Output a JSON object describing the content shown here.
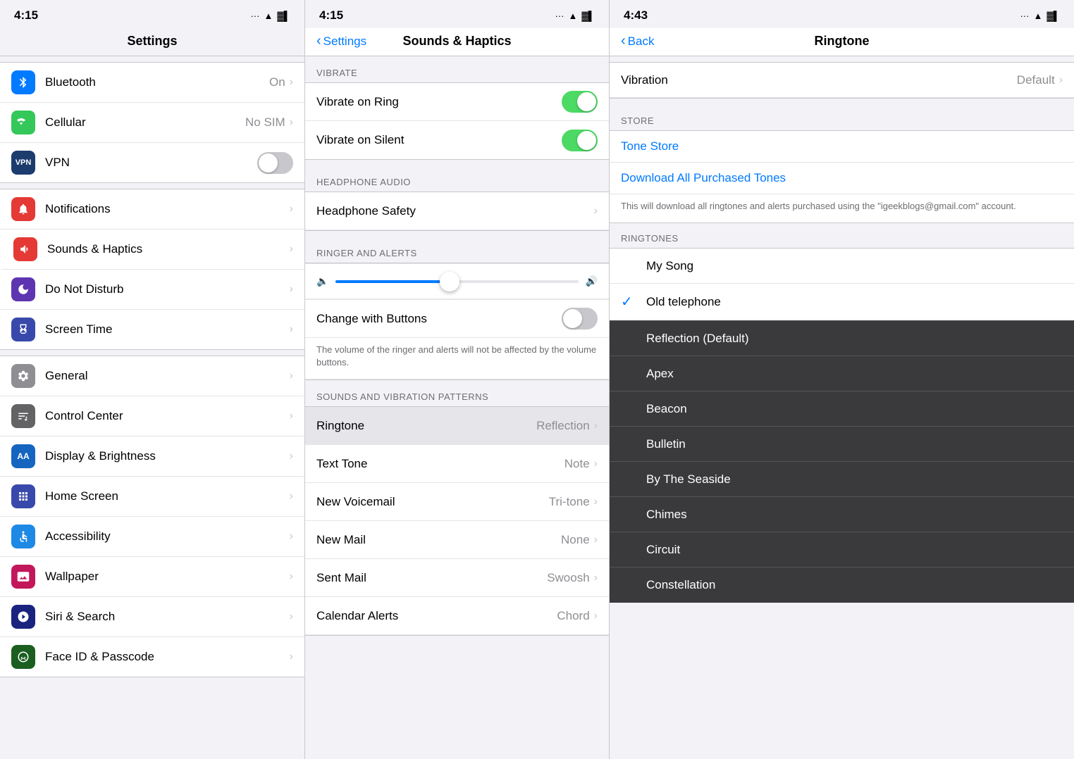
{
  "panel1": {
    "status": {
      "time": "4:15",
      "signal": "···",
      "wifi": "WiFi",
      "battery": "🔋"
    },
    "title": "Settings",
    "groups": [
      {
        "items": [
          {
            "icon": "bluetooth",
            "iconClass": "icon-blue",
            "label": "Bluetooth",
            "value": "On",
            "chevron": true
          },
          {
            "icon": "cellular",
            "iconClass": "icon-green",
            "label": "Cellular",
            "value": "No SIM",
            "chevron": true
          },
          {
            "icon": "vpn",
            "iconClass": "icon-dark-blue",
            "label": "VPN",
            "toggle": true,
            "toggleOn": false
          }
        ]
      },
      {
        "items": [
          {
            "icon": "bell",
            "iconClass": "icon-red",
            "label": "Notifications",
            "chevron": true
          },
          {
            "icon": "speaker",
            "iconClass": "icon-sound",
            "label": "Sounds & Haptics",
            "chevron": true,
            "active": true
          },
          {
            "icon": "moon",
            "iconClass": "icon-purple",
            "label": "Do Not Disturb",
            "chevron": true
          },
          {
            "icon": "hourglass",
            "iconClass": "icon-indigo",
            "label": "Screen Time",
            "chevron": true
          }
        ]
      },
      {
        "items": [
          {
            "icon": "gear",
            "iconClass": "icon-gray",
            "label": "General",
            "chevron": true
          },
          {
            "icon": "control",
            "iconClass": "icon-dark-gray",
            "label": "Control Center",
            "chevron": true
          },
          {
            "icon": "aa",
            "iconClass": "icon-aa",
            "label": "Display & Brightness",
            "chevron": true
          },
          {
            "icon": "dots",
            "iconClass": "icon-dots",
            "label": "Home Screen",
            "chevron": true
          },
          {
            "icon": "accessibility",
            "iconClass": "icon-accessibility",
            "label": "Accessibility",
            "chevron": true
          },
          {
            "icon": "wallpaper",
            "iconClass": "icon-wallpaper",
            "label": "Wallpaper",
            "chevron": true
          },
          {
            "icon": "siri",
            "iconClass": "icon-siri",
            "label": "Siri & Search",
            "chevron": true
          },
          {
            "icon": "faceid",
            "iconClass": "icon-faceid",
            "label": "Face ID & Passcode",
            "chevron": true
          }
        ]
      }
    ]
  },
  "panel2": {
    "status": {
      "time": "4:15"
    },
    "navBack": "Settings",
    "title": "Sounds & Haptics",
    "sections": {
      "vibrate": {
        "header": "VIBRATE",
        "items": [
          {
            "label": "Vibrate on Ring",
            "toggleOn": true
          },
          {
            "label": "Vibrate on Silent",
            "toggleOn": true
          }
        ]
      },
      "headphone": {
        "header": "HEADPHONE AUDIO",
        "items": [
          {
            "label": "Headphone Safety",
            "chevron": true
          }
        ]
      },
      "ringer": {
        "header": "RINGER AND ALERTS",
        "sliderValue": 45,
        "changeWithButtons": {
          "label": "Change with Buttons",
          "toggleOn": false
        },
        "note": "The volume of the ringer and alerts will not be affected by the volume buttons."
      },
      "patterns": {
        "header": "SOUNDS AND VIBRATION PATTERNS",
        "items": [
          {
            "label": "Ringtone",
            "value": "Reflection",
            "chevron": true,
            "highlighted": true
          },
          {
            "label": "Text Tone",
            "value": "Note",
            "chevron": true
          },
          {
            "label": "New Voicemail",
            "value": "Tri-tone",
            "chevron": true
          },
          {
            "label": "New Mail",
            "value": "None",
            "chevron": true
          },
          {
            "label": "Sent Mail",
            "value": "Swoosh",
            "chevron": true
          },
          {
            "label": "Calendar Alerts",
            "value": "Chord",
            "chevron": true
          }
        ]
      }
    }
  },
  "panel3": {
    "status": {
      "time": "4:43"
    },
    "navBack": "Back",
    "title": "Ringtone",
    "vibration": {
      "label": "Vibration",
      "value": "Default",
      "chevron": true
    },
    "store": {
      "header": "STORE",
      "toneStore": "Tone Store",
      "downloadAll": "Download All Purchased Tones",
      "note": "This will download all ringtones and alerts purchased using the \"igeekblogs@gmail.com\" account."
    },
    "ringtones": {
      "header": "RINGTONES",
      "items": [
        {
          "label": "My Song",
          "selected": false,
          "dark": false
        },
        {
          "label": "Old telephone",
          "selected": true,
          "dark": false
        },
        {
          "label": "Reflection (Default)",
          "selected": false,
          "dark": true
        },
        {
          "label": "Apex",
          "selected": false,
          "dark": true
        },
        {
          "label": "Beacon",
          "selected": false,
          "dark": true
        },
        {
          "label": "Bulletin",
          "selected": false,
          "dark": true
        },
        {
          "label": "By The Seaside",
          "selected": false,
          "dark": true
        },
        {
          "label": "Chimes",
          "selected": false,
          "dark": true
        },
        {
          "label": "Circuit",
          "selected": false,
          "dark": true
        },
        {
          "label": "Constellation",
          "selected": false,
          "dark": true
        }
      ]
    }
  },
  "icons": {
    "bluetooth": "B",
    "chevron": "›",
    "check": "✓"
  }
}
